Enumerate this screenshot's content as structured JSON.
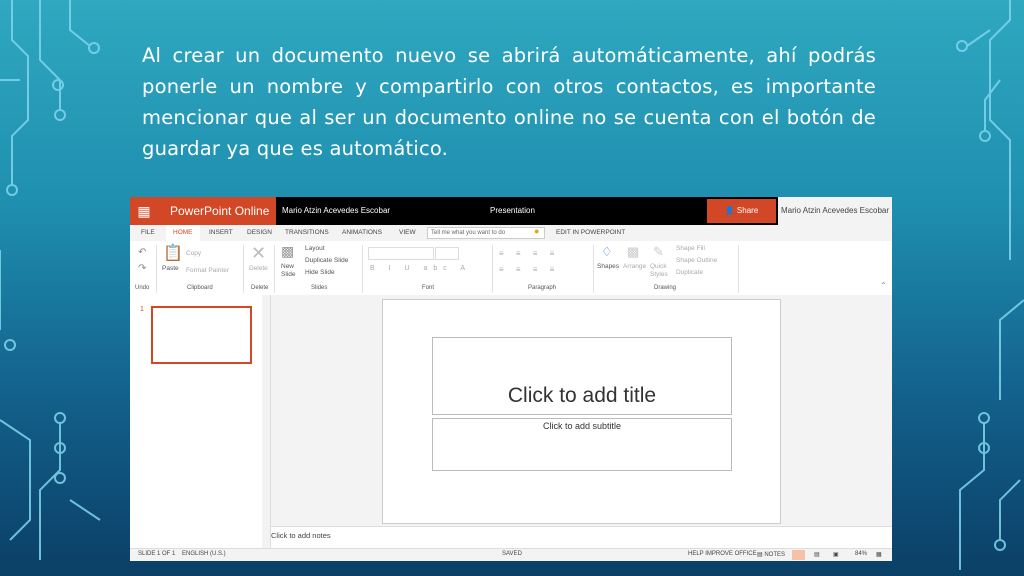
{
  "colors": {
    "accent": "#d24726",
    "background": "#1f8fb0",
    "text": "#ffffff"
  },
  "heading": {
    "text": "Al crear un documento nuevo se abrirá automáticamente, ahí podrás ponerle un nombre y compartirlo con otros contactos, es importante mencionar que al ser un documento online no se cuenta con el botón de guardar ya que es automático."
  },
  "ppt": {
    "app_name": "PowerPoint Online",
    "owner": "Mario Atzin Acevedes Escobar",
    "document_name": "Presentation",
    "share_label": "Share",
    "user_name": "Mario Atzin Acevedes Escobar",
    "tabs": [
      "FILE",
      "HOME",
      "INSERT",
      "DESIGN",
      "TRANSITIONS",
      "ANIMATIONS",
      "VIEW"
    ],
    "tell_me_placeholder": "Tell me what you want to do",
    "edit_in_app": "EDIT IN POWERPOINT",
    "ribbon": {
      "paste": "Paste",
      "copy": "Copy",
      "format_painter": "Format Painter",
      "delete": "Delete",
      "new_slide": "New Slide",
      "layout": "Layout",
      "duplicate_slide": "Duplicate Slide",
      "hide_slide": "Hide Slide",
      "shapes": "Shapes",
      "arrange": "Arrange",
      "quick_styles": "Quick Styles",
      "shape_fill": "Shape Fill",
      "shape_outline": "Shape Outline",
      "duplicate": "Duplicate",
      "groups": [
        "Undo",
        "Clipboard",
        "Delete",
        "Slides",
        "Font",
        "Paragraph",
        "Drawing"
      ]
    },
    "slide_number": "1",
    "title_placeholder": "Click to add title",
    "subtitle_placeholder": "Click to add subtitle",
    "notes_placeholder": "Click to add notes",
    "status": {
      "slide_count": "SLIDE 1 OF 1",
      "language": "ENGLISH (U.S.)",
      "saved": "SAVED",
      "help": "HELP IMPROVE OFFICE",
      "notes": "NOTES",
      "zoom": "84%"
    }
  }
}
